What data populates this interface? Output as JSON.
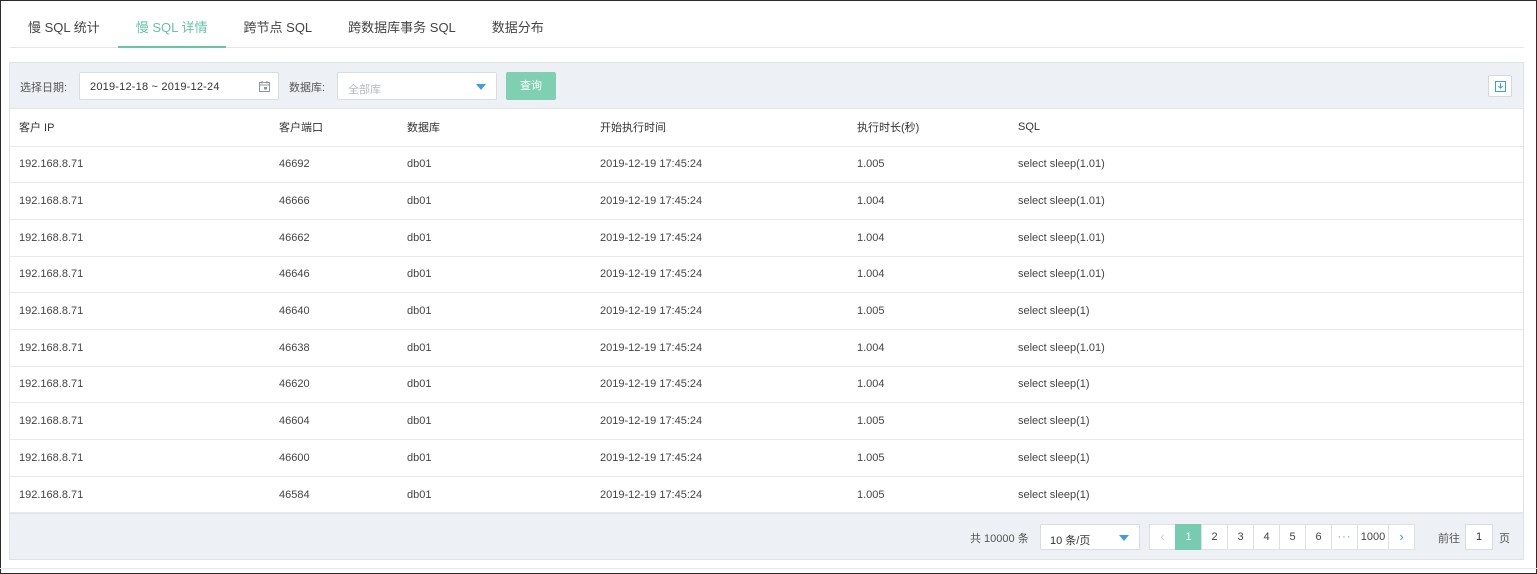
{
  "tabs": [
    {
      "label": "慢 SQL 统计",
      "active": false
    },
    {
      "label": "慢 SQL 详情",
      "active": true
    },
    {
      "label": "跨节点 SQL",
      "active": false
    },
    {
      "label": "跨数据库事务 SQL",
      "active": false
    },
    {
      "label": "数据分布",
      "active": false
    }
  ],
  "toolbar": {
    "date_label": "选择日期:",
    "date_value": "2019-12-18 ~ 2019-12-24",
    "db_label": "数据库:",
    "db_placeholder": "全部库",
    "query_label": "查询"
  },
  "table": {
    "headers": [
      "客户 IP",
      "客户端口",
      "数据库",
      "开始执行时间",
      "执行时长(秒)",
      "SQL"
    ],
    "rows": [
      [
        "192.168.8.71",
        "46692",
        "db01",
        "2019-12-19 17:45:24",
        "1.005",
        "select sleep(1.01)"
      ],
      [
        "192.168.8.71",
        "46666",
        "db01",
        "2019-12-19 17:45:24",
        "1.004",
        "select sleep(1.01)"
      ],
      [
        "192.168.8.71",
        "46662",
        "db01",
        "2019-12-19 17:45:24",
        "1.004",
        "select sleep(1.01)"
      ],
      [
        "192.168.8.71",
        "46646",
        "db01",
        "2019-12-19 17:45:24",
        "1.004",
        "select sleep(1.01)"
      ],
      [
        "192.168.8.71",
        "46640",
        "db01",
        "2019-12-19 17:45:24",
        "1.005",
        "select sleep(1)"
      ],
      [
        "192.168.8.71",
        "46638",
        "db01",
        "2019-12-19 17:45:24",
        "1.004",
        "select sleep(1.01)"
      ],
      [
        "192.168.8.71",
        "46620",
        "db01",
        "2019-12-19 17:45:24",
        "1.004",
        "select sleep(1)"
      ],
      [
        "192.168.8.71",
        "46604",
        "db01",
        "2019-12-19 17:45:24",
        "1.005",
        "select sleep(1)"
      ],
      [
        "192.168.8.71",
        "46600",
        "db01",
        "2019-12-19 17:45:24",
        "1.005",
        "select sleep(1)"
      ],
      [
        "192.168.8.71",
        "46584",
        "db01",
        "2019-12-19 17:45:24",
        "1.005",
        "select sleep(1)"
      ]
    ]
  },
  "pagination": {
    "total_text": "共 10000 条",
    "page_size": "10 条/页",
    "prev": "‹",
    "pages": [
      "1",
      "2",
      "3",
      "4",
      "5",
      "6"
    ],
    "dots": "···",
    "last": "1000",
    "next": "›",
    "active_page": "1",
    "goto_label": "前往",
    "goto_value": "1",
    "page_unit": "页"
  },
  "colors": {
    "accent": "#67c4a7",
    "link": "#3f9de6",
    "toolbar_bg": "#edf1f5"
  },
  "icons": {
    "calendar": "calendar-icon",
    "dropdown": "chevron-down-icon",
    "export": "download-icon"
  }
}
